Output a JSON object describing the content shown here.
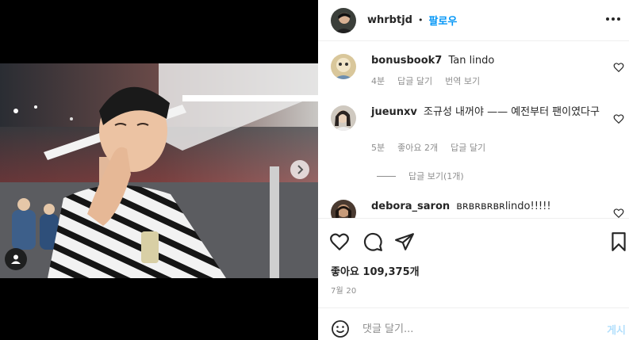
{
  "post": {
    "username": "whrbtjd",
    "separator": "•",
    "follow_label": "팔로우",
    "more_icon": "more-horizontal-icon"
  },
  "comments": [
    {
      "username": "bonusbook7",
      "text": "Tan lindo",
      "time": "4분",
      "reply_label": "답글 달기",
      "translate_label": "번역 보기"
    },
    {
      "username": "jueunxv",
      "text": "조규성 내꺼야 —— 예전부터 팬이였다구",
      "time": "5분",
      "likes_label": "좋아요 2개",
      "reply_label": "답글 달기",
      "view_replies": "답글 보기(1개)"
    },
    {
      "username": "debora_saron",
      "text": "ʙʀʙʀʙʀʙʀlindo!!!!!"
    }
  ],
  "actions": {
    "like_icon": "heart-icon",
    "comment_icon": "comment-icon",
    "share_icon": "send-icon",
    "save_icon": "bookmark-icon"
  },
  "likes_text": "좋아요 109,375개",
  "date_text": "7월 20",
  "add_comment": {
    "placeholder": "댓글 달기...",
    "post_label": "게시",
    "emoji_icon": "smile-icon"
  },
  "colors": {
    "accent": "#0095f6",
    "post_disabled": "#b2dffc",
    "muted": "#8e8e8e",
    "border": "#efefef"
  }
}
